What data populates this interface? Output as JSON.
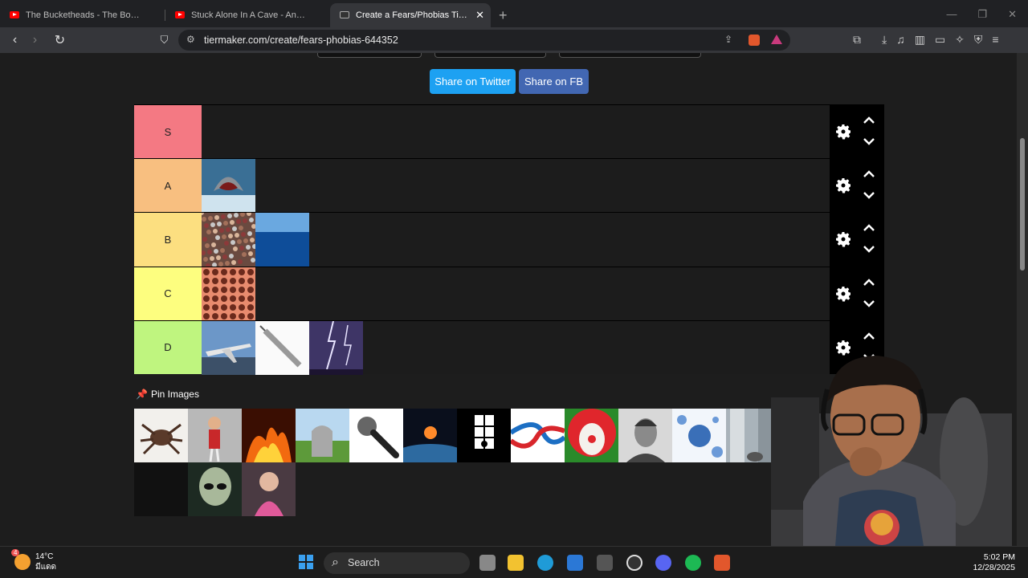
{
  "browser": {
    "tabs": [
      {
        "title": "The Bucketheads - The Bomb [These"
      },
      {
        "title": "Stuck Alone In A Cave - Anxiety Warn"
      },
      {
        "title": "Create a Fears/Phobias Tier List",
        "active": true
      }
    ],
    "url": "tiermaker.com/create/fears-phobias-644352",
    "brave_badge": "1"
  },
  "page": {
    "share_twitter": "Share on Twitter",
    "share_fb": "Share on FB",
    "pin_images": "Pin Images",
    "tiers": [
      {
        "label": "S",
        "color": "#f47983",
        "items": []
      },
      {
        "label": "A",
        "color": "#f8bf80",
        "items": [
          "shark"
        ]
      },
      {
        "label": "B",
        "color": "#fcdf80",
        "items": [
          "crowd",
          "ocean"
        ]
      },
      {
        "label": "C",
        "color": "#fdfe7f",
        "items": [
          "holes"
        ]
      },
      {
        "label": "D",
        "color": "#bff57f",
        "items": [
          "airplane",
          "syringe",
          "lightning"
        ]
      }
    ],
    "pool": [
      "spider",
      "puppet",
      "fire",
      "gravestone",
      "microphone",
      "asteroid",
      "window",
      "knot",
      "clown",
      "man-portrait",
      "virus",
      "heights",
      "dark",
      "alien",
      "scared-person"
    ]
  },
  "taskbar": {
    "temp": "14°C",
    "weather_desc": "มีแดด",
    "weather_badge": "4",
    "search": "Search",
    "time": "5:02 PM",
    "date": "12/28/2025"
  }
}
